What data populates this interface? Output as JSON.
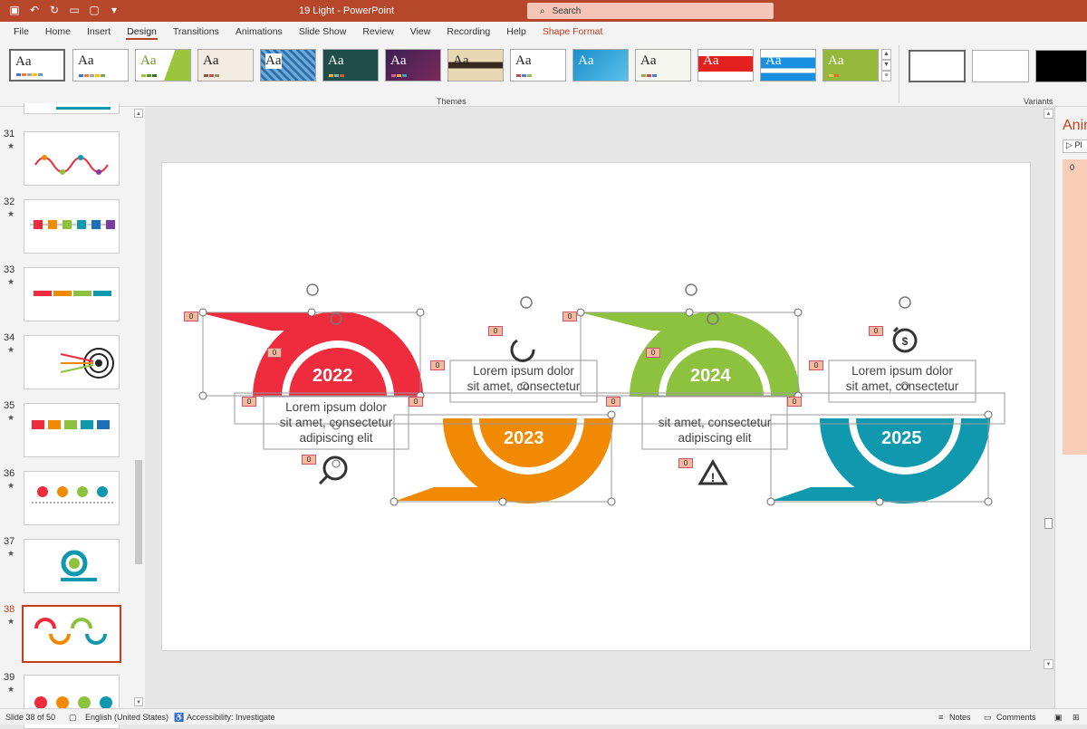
{
  "window": {
    "title": "19 Light  -  PowerPoint",
    "search_placeholder": "Search"
  },
  "tabs": [
    "File",
    "Home",
    "Insert",
    "Design",
    "Transitions",
    "Animations",
    "Slide Show",
    "Review",
    "View",
    "Recording",
    "Help",
    "Shape Format"
  ],
  "ribbon": {
    "themes_label": "Themes",
    "variants_label": "Variants",
    "theme_thumb_text": "Aa"
  },
  "slides_pane": {
    "items": [
      {
        "number": "31",
        "star": "★"
      },
      {
        "number": "32",
        "star": "★"
      },
      {
        "number": "33",
        "star": "★"
      },
      {
        "number": "34",
        "star": "★"
      },
      {
        "number": "35",
        "star": "★"
      },
      {
        "number": "36",
        "star": "★"
      },
      {
        "number": "37",
        "star": "★"
      },
      {
        "number": "38",
        "star": "★"
      },
      {
        "number": "39",
        "star": "★"
      }
    ],
    "selected": "38"
  },
  "slide": {
    "years": [
      "2022",
      "2023",
      "2024",
      "2025"
    ],
    "text_lines": [
      "Lorem ipsum dolor",
      "sit amet, consectetur",
      "adipiscing elit"
    ],
    "anim_tag": "0",
    "colors": {
      "red": "#ef2b3e",
      "orange": "#f18a00",
      "green": "#8dc23f",
      "teal": "#0f98ae"
    }
  },
  "anim_pane": {
    "title": "Anim",
    "play_label": "Pl",
    "item_number": "0"
  },
  "status": {
    "slide_info": "Slide 38 of 50",
    "language": "English (United States)",
    "accessibility": "Accessibility: Investigate",
    "notes": "Notes",
    "comments": "Comments"
  }
}
